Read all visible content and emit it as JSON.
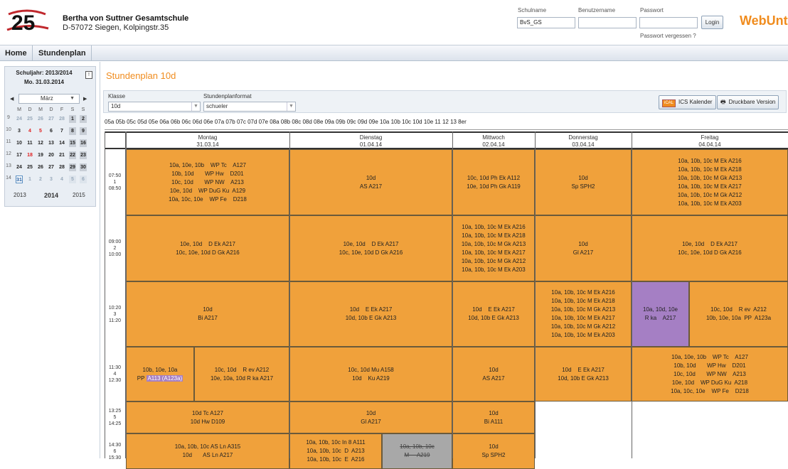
{
  "header": {
    "school_name": "Bertha von Suttner Gesamtschule",
    "school_address": "D-57072 Siegen, Kolpingstr.35",
    "logo_text": "25",
    "schulname_label": "Schulname",
    "schulname_value": "BvS_GS",
    "benutzername_label": "Benutzername",
    "benutzername_value": "",
    "passwort_label": "Passwort",
    "passwort_value": "",
    "login_button": "Login",
    "forgot_password": "Passwort vergessen ?",
    "brand": "WebUntis"
  },
  "nav": {
    "home": "Home",
    "stundenplan": "Stundenplan"
  },
  "calendar": {
    "schuljahr": "Schuljahr: 2013/2014",
    "date": "Mo. 31.03.2014",
    "month": "März",
    "day_headers": [
      "M",
      "D",
      "M",
      "D",
      "F",
      "S",
      "S"
    ],
    "weeks": [
      {
        "kw": "9",
        "days": [
          "24",
          "25",
          "26",
          "27",
          "28",
          "1",
          "2"
        ]
      },
      {
        "kw": "10",
        "days": [
          "3",
          "4",
          "5",
          "6",
          "7",
          "8",
          "9"
        ]
      },
      {
        "kw": "11",
        "days": [
          "10",
          "11",
          "12",
          "13",
          "14",
          "15",
          "16"
        ]
      },
      {
        "kw": "12",
        "days": [
          "17",
          "18",
          "19",
          "20",
          "21",
          "22",
          "23"
        ]
      },
      {
        "kw": "13",
        "days": [
          "24",
          "25",
          "26",
          "27",
          "28",
          "29",
          "30"
        ]
      },
      {
        "kw": "14",
        "days": [
          "31",
          "1",
          "2",
          "3",
          "4",
          "5",
          "6"
        ]
      }
    ],
    "years": [
      "2013",
      "2014",
      "2015"
    ]
  },
  "main": {
    "title": "Stundenplan 10d",
    "klasse_label": "Klasse",
    "klasse_value": "10d",
    "format_label": "Stundenplanformat",
    "format_value": "schueler",
    "ics_button": "ICS Kalender",
    "print_button": "Druckbare Version",
    "class_list": "05a 05b 05c 05d 05e 06a 06b 06c 06d 06e 07a 07b 07c 07d 07e 08a 08b 08c 08d 08e 09a 09b 09c 09d 09e 10a 10b 10c 10d 10e 11 12 13 8er"
  },
  "days": [
    {
      "name": "Montag",
      "date": "31.03.14"
    },
    {
      "name": "Dienstag",
      "date": "01.04.14"
    },
    {
      "name": "Mittwoch",
      "date": "02.04.14"
    },
    {
      "name": "Donnerstag",
      "date": "03.04.14"
    },
    {
      "name": "Freitag",
      "date": "04.04.14"
    }
  ],
  "periods": [
    {
      "start": "07:50",
      "num": "1",
      "end": "08:50"
    },
    {
      "start": "09:00",
      "num": "2",
      "end": "10:00"
    },
    {
      "start": "10:20",
      "num": "3",
      "end": "11:20"
    },
    {
      "start": "11:30",
      "num": "4",
      "end": "12:30"
    },
    {
      "start": "13:25",
      "num": "5",
      "end": "14:25"
    },
    {
      "start": "14:30",
      "num": "6",
      "end": "15:30"
    }
  ],
  "lessons": {
    "mo1": [
      "10a, 10e, 10b    WP Tc    A127",
      "10b, 10d       WP Hw    D201",
      "10c, 10d       WP NW    A213",
      "10e, 10d    WP DuG Ku  A129",
      "10a, 10c, 10e    WP Fe    D218"
    ],
    "di1": [
      "10d",
      "AS A217"
    ],
    "mi1": [
      "10c, 10d Ph Ek A112",
      "10e, 10d Ph Gk A119"
    ],
    "do1": [
      "10d",
      "Sp SPH2"
    ],
    "fr1": [
      "10a, 10b, 10c M Ek A216",
      "10a, 10b, 10c M Ek A218",
      "10a, 10b, 10c M Gk A213",
      "10a, 10b, 10c M Ek A217",
      "10a, 10b, 10c M Gk A212",
      "10a, 10b, 10c M Ek A203"
    ],
    "mo2": [
      "10e, 10d    D Ek A217",
      "10c, 10e, 10d D Gk A216"
    ],
    "di2": [
      "10e, 10d    D Ek A217",
      "10c, 10e, 10d D Gk A216"
    ],
    "mi2": [
      "10a, 10b, 10c M Ek A216",
      "10a, 10b, 10c M Ek A218",
      "10a, 10b, 10c M Gk A213",
      "10a, 10b, 10c M Ek A217",
      "10a, 10b, 10c M Gk A212",
      "10a, 10b, 10c M Ek A203"
    ],
    "do2": [
      "10d",
      "Gl A217"
    ],
    "fr2": [
      "10e, 10d    D Ek A217",
      "10c, 10e, 10d D Gk A216"
    ],
    "mo3": [
      "10d",
      "Bi A217"
    ],
    "di3": [
      "10d    E Ek A217",
      "10d, 10b E Gk A213"
    ],
    "mi3": [
      "10d    E Ek A217",
      "10d, 10b E Gk A213"
    ],
    "do3": [
      "10a, 10b, 10c M Ek A216",
      "10a, 10b, 10c M Ek A218",
      "10a, 10b, 10c M Gk A213",
      "10a, 10b, 10c M Ek A217",
      "10a, 10b, 10c M Gk A212",
      "10a, 10b, 10c M Ek A203"
    ],
    "fr3a": [
      "10a, 10d, 10e",
      "R ka    A217"
    ],
    "fr3b": [
      "10c, 10d    R ev  A212",
      "10b, 10e, 10a  PP  A123a"
    ],
    "mo4a_1": "10b, 10e, 10a",
    "mo4a_2": "PP",
    "mo4a_room": "A113 (A123a)",
    "mo4b": [
      "10c, 10d    R ev A212",
      "10e, 10a, 10d R ka A217"
    ],
    "di4": [
      "10c, 10d Mu A158",
      "10d    Ku A219"
    ],
    "mi4": [
      "10d",
      "AS A217"
    ],
    "do4": [
      "10d    E Ek A217",
      "10d, 10b E Gk A213"
    ],
    "fr4": [
      "10a, 10e, 10b    WP Tc    A127",
      "10b, 10d       WP Hw    D201",
      "10c, 10d       WP NW    A213",
      "10e, 10d    WP DuG Ku  A218",
      "10a, 10c, 10e    WP Fe    D218"
    ],
    "mo5": [
      "10d Tc A127",
      "10d Hw D109"
    ],
    "di5": [
      "10d",
      "Gl A217"
    ],
    "mi5": [
      "10d",
      "Bi A111"
    ],
    "mo6": [
      "10a, 10b, 10c AS Ln A315",
      "10d       AS Ln A217"
    ],
    "di6a": [
      "10a, 10b, 10c In 8 A111",
      "10a, 10b, 10c  D  A213",
      "10a, 10b, 10c  E  A216"
    ],
    "di6b": [
      "10a, 10b, 10c",
      "M     A219"
    ],
    "mi6": [
      "10d",
      "Sp SPH2"
    ]
  },
  "colors": {
    "accent": "#f08c1e",
    "lesson": "#f0a13b",
    "religion": "#a57fc4",
    "cancelled": "#a8a8a8"
  }
}
